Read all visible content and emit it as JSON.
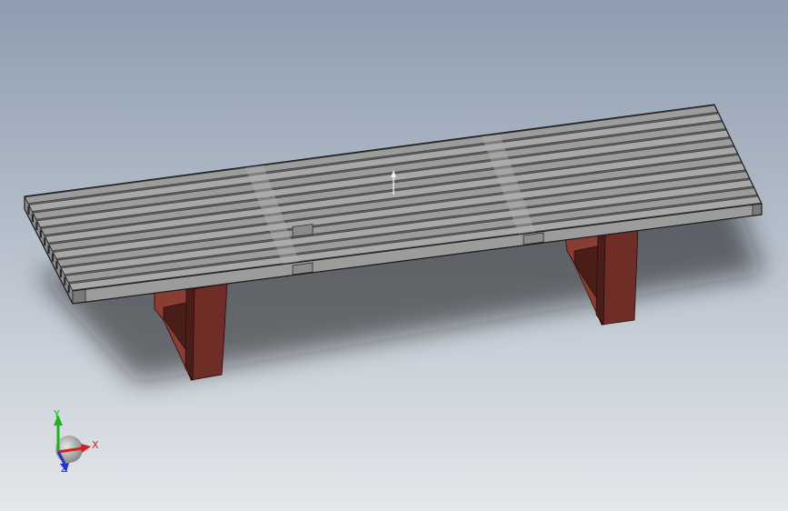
{
  "viewport": {
    "background_top": "#8e9db0",
    "background_bottom": "#e4e7eb"
  },
  "model": {
    "slat_count": 12,
    "slat_color": "#9c9c9c",
    "slat_top_color": "#a8a8a8",
    "slat_dark": "#5e5e5e",
    "leg_color": "#6e2e27",
    "leg_dark": "#4a1d18",
    "leg_light": "#8a3e33"
  },
  "triad": {
    "x_label": "X",
    "y_label": "Y",
    "z_label": "Z",
    "x_color": "#d42020",
    "y_color": "#1db31d",
    "z_color": "#2233cc"
  }
}
